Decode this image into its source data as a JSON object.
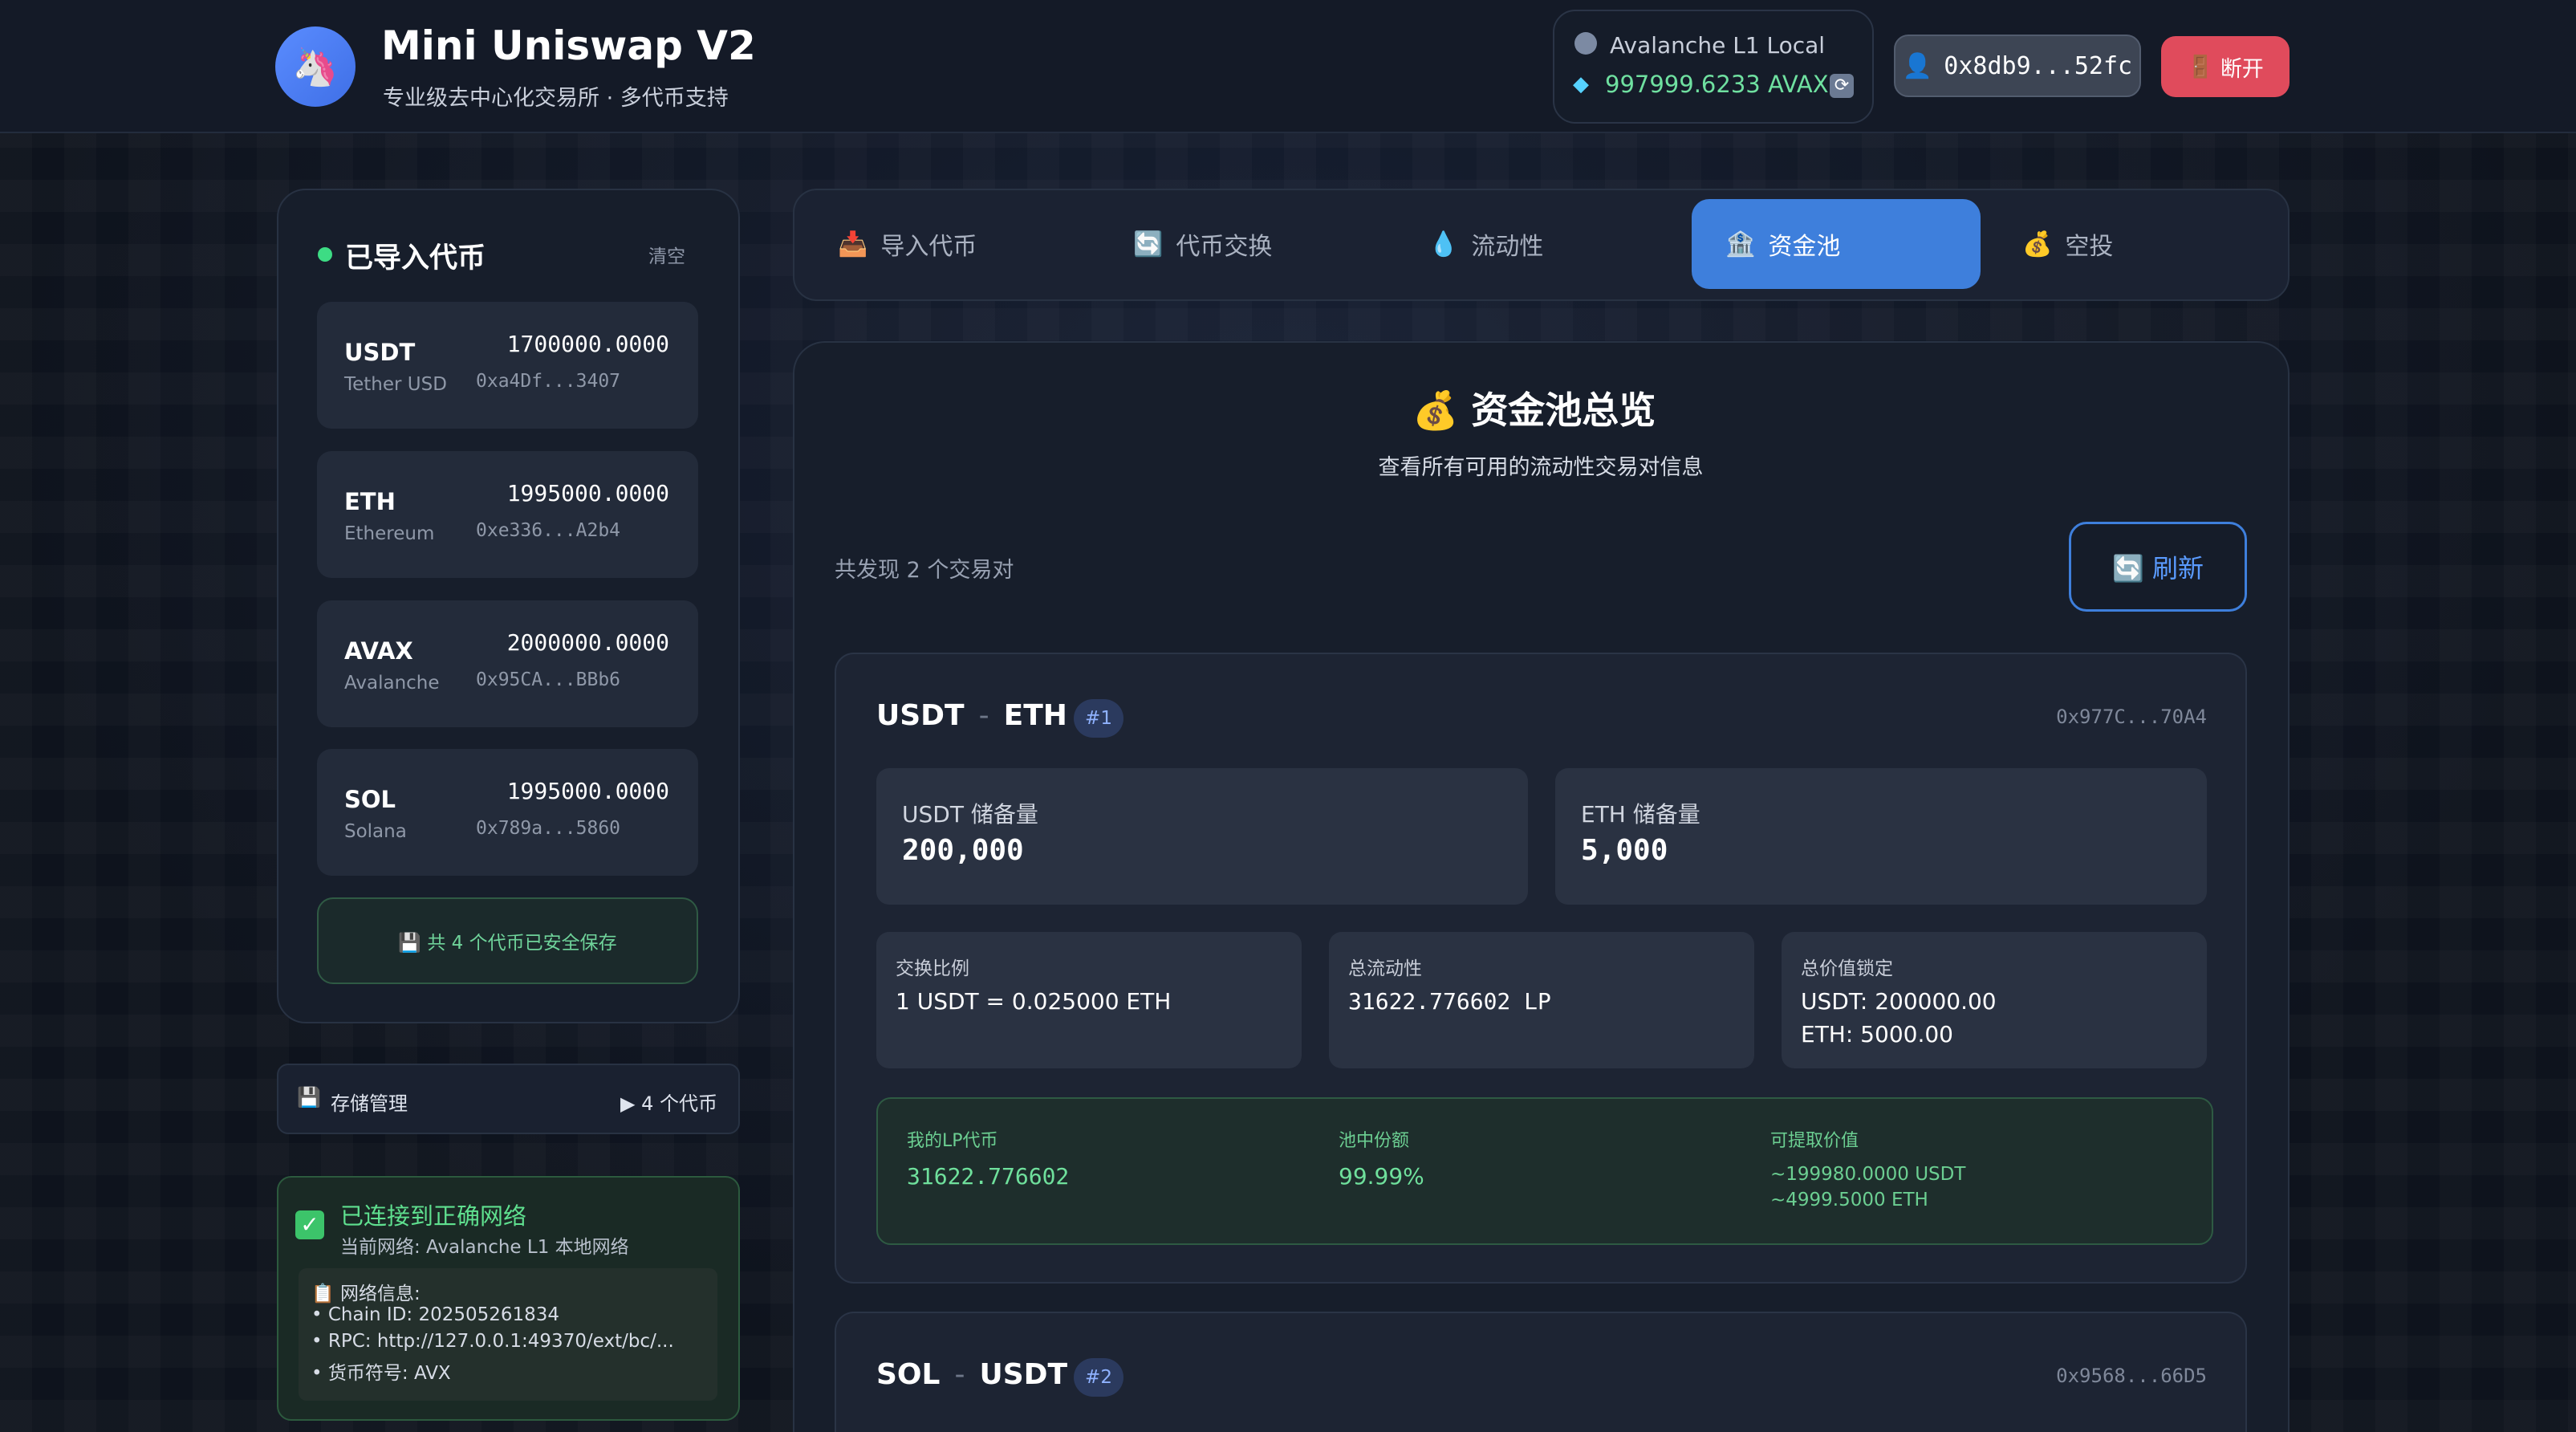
{
  "header": {
    "logo_glyph": "🦄",
    "title": "Mini Uniswap V2",
    "subtitle": "专业级去中心化交易所 · 多代币支持",
    "network_name": "Avalanche L1 Local",
    "balance": "997999.6233 AVAX",
    "wallet_icon": "👤",
    "wallet_address": "0x8db9...52fc",
    "disconnect_icon": "🚪",
    "disconnect_label": "断开"
  },
  "sidebar": {
    "title": "已导入代币",
    "clear_label": "清空",
    "tokens": [
      {
        "symbol": "USDT",
        "name": "Tether USD",
        "balance": "1700000.0000",
        "address": "0xa4Df...3407"
      },
      {
        "symbol": "ETH",
        "name": "Ethereum",
        "balance": "1995000.0000",
        "address": "0xe336...A2b4"
      },
      {
        "symbol": "AVAX",
        "name": "Avalanche",
        "balance": "2000000.0000",
        "address": "0x95CA...BBb6"
      },
      {
        "symbol": "SOL",
        "name": "Solana",
        "balance": "1995000.0000",
        "address": "0x789a...5860"
      }
    ],
    "saved_note": "💾 共 4 个代币已安全保存",
    "storage_icon": "💾",
    "storage_label": "存储管理",
    "storage_count": "▶ 4 个代币",
    "network_ok_title": "已连接到正确网络",
    "network_ok_sub": "当前网络: Avalanche L1 本地网络",
    "network_info": [
      "📋 网络信息:",
      "• Chain ID: 202505261834",
      "• RPC: http://127.0.0.1:49370/ext/bc/...",
      "• 货币符号: AVX"
    ]
  },
  "tabs": [
    {
      "icon": "📥",
      "label": "导入代币"
    },
    {
      "icon": "🔄",
      "label": "代币交换"
    },
    {
      "icon": "💧",
      "label": "流动性"
    },
    {
      "icon": "🏦",
      "label": "资金池"
    },
    {
      "icon": "💰",
      "label": "空投"
    }
  ],
  "main": {
    "title": "💰 资金池总览",
    "subtitle": "查看所有可用的流动性交易对信息",
    "pair_count": "共发现 2 个交易对",
    "refresh_label": "🔄 刷新"
  },
  "pools": [
    {
      "token_a": "USDT",
      "token_b": "ETH",
      "id": "#1",
      "address": "0x977C...70A4",
      "reserve_a_label": "USDT 储备量",
      "reserve_a": "200,000",
      "reserve_b_label": "ETH 储备量",
      "reserve_b": "5,000",
      "rate_label": "交换比例",
      "rate": "1 USDT = 0.025000 ETH",
      "liquidity_label": "总流动性",
      "liquidity": "31622.776602 LP",
      "tvl_label": "总价值锁定",
      "tvl_a": "USDT: 200000.00",
      "tvl_b": "ETH: 5000.00",
      "my_lp_label": "我的LP代币",
      "my_lp": "31622.776602",
      "share_label": "池中份额",
      "share": "99.99%",
      "withdraw_label": "可提取价值",
      "withdraw_a": "~199980.0000 USDT",
      "withdraw_b": "~4999.5000 ETH"
    },
    {
      "token_a": "SOL",
      "token_b": "USDT",
      "id": "#2",
      "address": "0x9568...66D5"
    }
  ]
}
